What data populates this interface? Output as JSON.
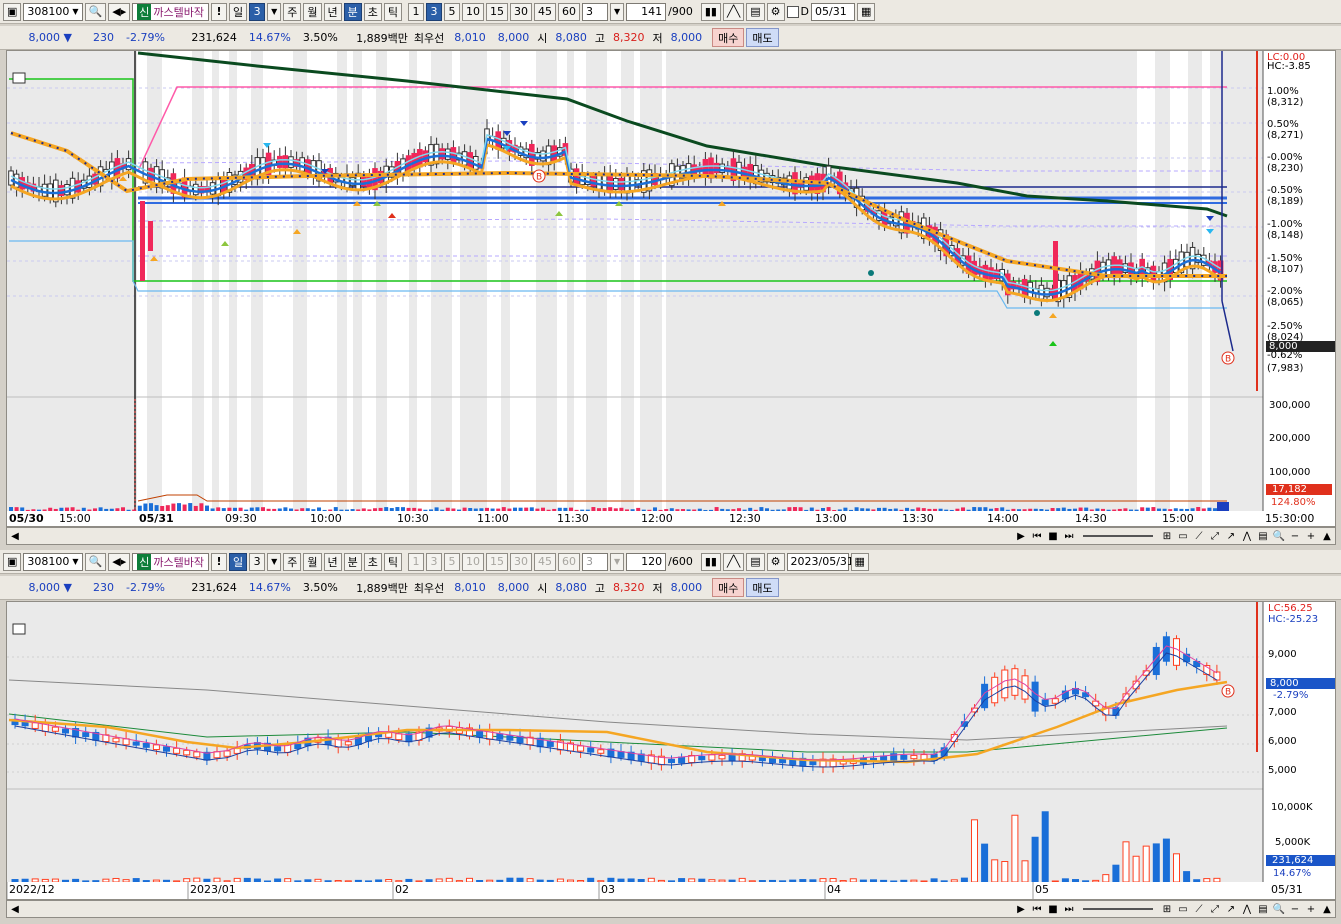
{
  "panel1": {
    "code": "308100",
    "sin": "신",
    "name": "까스텔바작",
    "excl": "!",
    "period_day": "일",
    "period_num": "3",
    "periods": [
      "주",
      "월",
      "년",
      "분",
      "초",
      "틱"
    ],
    "intervals": [
      "1",
      "3",
      "5",
      "10",
      "15",
      "30",
      "45",
      "60"
    ],
    "custom": "3",
    "count": "141",
    "count_max": "/900",
    "d_label": "D",
    "date": "05/31",
    "quote": {
      "price": "8,000",
      "arrow": "▼",
      "change": "230",
      "rate": "-2.79%",
      "volume": "231,624",
      "turnover": "14.67%",
      "pct": "3.50%",
      "amount": "1,889백만",
      "best_label": "최우선",
      "best_ask": "8,010",
      "best_bid": "8,000",
      "open_label": "시",
      "open": "8,080",
      "high_label": "고",
      "high": "8,320",
      "low_label": "저",
      "low": "8,000",
      "buy": "매수",
      "sell": "매도"
    },
    "price_axis": [
      {
        "t": "LC:0.00",
        "c": "#e0201c"
      },
      {
        "t": "HC:-3.85",
        "c": "#000"
      },
      {
        "t": "1.00%",
        "c": "#000"
      },
      {
        "t": "(8,312)",
        "c": "#000"
      },
      {
        "t": "0.50%",
        "c": "#000"
      },
      {
        "t": "(8,271)",
        "c": "#000"
      },
      {
        "t": "-0.00%",
        "c": "#000"
      },
      {
        "t": "(8,230)",
        "c": "#000"
      },
      {
        "t": "-0.50%",
        "c": "#000"
      },
      {
        "t": "(8,189)",
        "c": "#000"
      },
      {
        "t": "-1.00%",
        "c": "#000"
      },
      {
        "t": "(8,148)",
        "c": "#000"
      },
      {
        "t": "-1.50%",
        "c": "#000"
      },
      {
        "t": "(8,107)",
        "c": "#000"
      },
      {
        "t": "-2.00%",
        "c": "#000"
      },
      {
        "t": "(8,065)",
        "c": "#000"
      },
      {
        "t": "-2.50%",
        "c": "#000"
      },
      {
        "t": "(8,024)",
        "c": "#000"
      },
      {
        "t": "-0.62%",
        "c": "#000"
      },
      {
        "t": "(7,983)",
        "c": "#000"
      }
    ],
    "price_tag": "8,000",
    "vol_axis": [
      "300,000",
      "200,000",
      "100,000"
    ],
    "vol_tag": "17,182",
    "vol_pct": "124.80%",
    "xlabels": [
      "05/30",
      "15:00",
      "05/31",
      "09:30",
      "10:00",
      "10:30",
      "11:00",
      "11:30",
      "12:00",
      "12:30",
      "13:00",
      "13:30",
      "14:00",
      "14:30",
      "15:00",
      "15:30:00"
    ]
  },
  "panel2": {
    "code": "308100",
    "sin": "신",
    "name": "까스텔바작",
    "excl": "!",
    "period_day": "일",
    "period_num": "3",
    "periods": [
      "주",
      "월",
      "년",
      "분",
      "초",
      "틱"
    ],
    "intervals": [
      "1",
      "3",
      "5",
      "10",
      "15",
      "30",
      "45",
      "60"
    ],
    "custom": "3",
    "count": "120",
    "count_max": "/600",
    "date": "2023/05/31",
    "quote": {
      "price": "8,000",
      "arrow": "▼",
      "change": "230",
      "rate": "-2.79%",
      "volume": "231,624",
      "turnover": "14.67%",
      "pct": "3.50%",
      "amount": "1,889백만",
      "best_label": "최우선",
      "best_ask": "8,010",
      "best_bid": "8,000",
      "open_label": "시",
      "open": "8,080",
      "high_label": "고",
      "high": "8,320",
      "low_label": "저",
      "low": "8,000",
      "buy": "매수",
      "sell": "매도"
    },
    "price_axis": [
      {
        "t": "LC:56.25",
        "c": "#e0201c"
      },
      {
        "t": "HC:-25.23",
        "c": "#1a3fbf"
      },
      {
        "t": "9,000",
        "c": "#000"
      },
      {
        "t": "7,000",
        "c": "#000"
      },
      {
        "t": "6,000",
        "c": "#000"
      },
      {
        "t": "5,000",
        "c": "#000"
      }
    ],
    "price_tag": "8,000",
    "price_tag2": "-2.79%",
    "vol_axis": [
      "10,000K",
      "5,000K"
    ],
    "vol_tag": "231,624",
    "vol_pct": "14.67%",
    "xlabels": [
      "2022/12",
      "2023/01",
      "02",
      "03",
      "04",
      "05",
      "05/31"
    ]
  },
  "colors": {
    "bull": "#f0285a",
    "bear": "#1a6fd8",
    "ma_orange": "#f5a623",
    "ma_green": "#0a6b2f",
    "ma_pink": "#e040a0",
    "ma_navy": "#1c2a8c"
  }
}
